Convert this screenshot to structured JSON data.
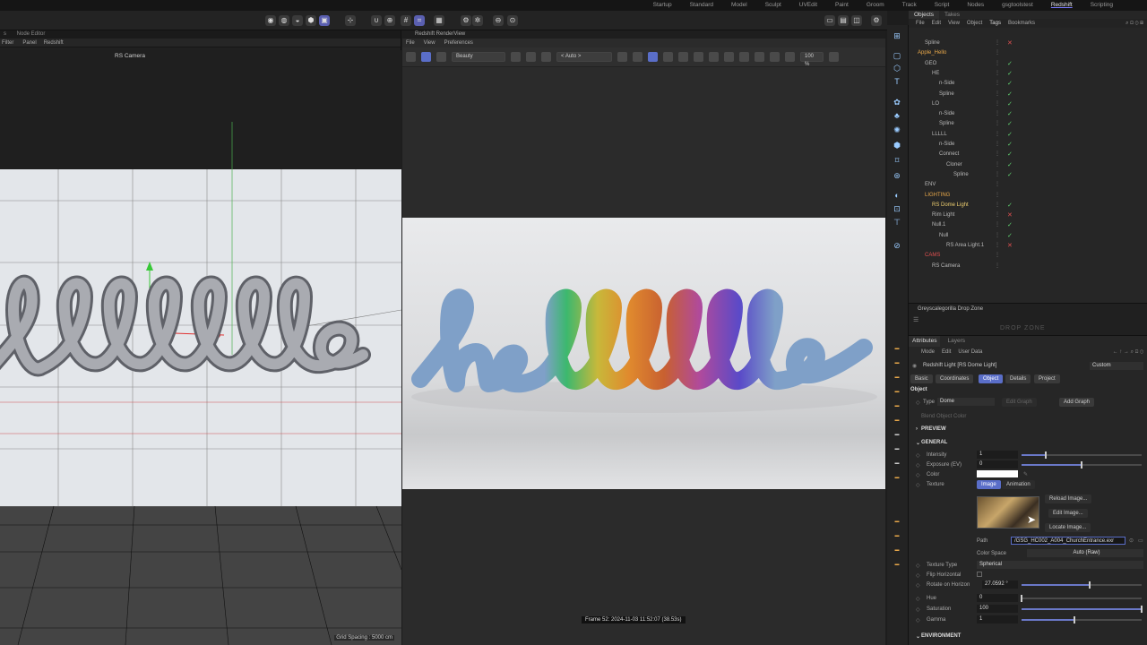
{
  "layouts": [
    "Startup",
    "Standard",
    "Model",
    "Sculpt",
    "UVEdit",
    "Paint",
    "Groom",
    "Track",
    "Script",
    "Nodes",
    "gsgtoolstest",
    "Redshift",
    "Scripting"
  ],
  "layouts_active": "Redshift",
  "left_panel": {
    "tabs": [
      "Node Editor"
    ],
    "menu": [
      "Filter",
      "Panel",
      "Redshift"
    ],
    "camera_label": "RS Camera",
    "grid_spacing": "Grid Spacing : 5000 cm"
  },
  "render_view": {
    "title": "Redshift RenderView",
    "menu": [
      "File",
      "View",
      "Preferences"
    ],
    "aov_select": "Beauty",
    "auto_select": "< Auto >",
    "zoom": "100 %",
    "status": "Frame 52: 2024-11-03 11:52:07 (38.53s)"
  },
  "objects_panel": {
    "tabs": [
      "Objects",
      "Takes"
    ],
    "menu": [
      "File",
      "Edit",
      "View",
      "Object",
      "Tags",
      "Bookmarks"
    ],
    "rows": [
      {
        "name": "Spline",
        "indent": 1,
        "color": "#b8b8b8",
        "check": "✕",
        "checkcolor": "#e05050"
      },
      {
        "name": "Apple_Hello",
        "indent": 0,
        "color": "#e8a84a",
        "check": "",
        "checkcolor": ""
      },
      {
        "name": "GEO",
        "indent": 1,
        "color": "#b8b8b8",
        "check": "✓",
        "checkcolor": "#5fd36f"
      },
      {
        "name": "HE",
        "indent": 2,
        "color": "#b8b8b8",
        "check": "✓",
        "checkcolor": "#5fd36f"
      },
      {
        "name": "n-Side",
        "indent": 3,
        "color": "#b8b8b8",
        "check": "✓",
        "checkcolor": "#5fd36f"
      },
      {
        "name": "Spline",
        "indent": 3,
        "color": "#b8b8b8",
        "check": "✓",
        "checkcolor": "#5fd36f"
      },
      {
        "name": "LO",
        "indent": 2,
        "color": "#b8b8b8",
        "check": "✓",
        "checkcolor": "#5fd36f"
      },
      {
        "name": "n-Side",
        "indent": 3,
        "color": "#b8b8b8",
        "check": "✓",
        "checkcolor": "#5fd36f"
      },
      {
        "name": "Spline",
        "indent": 3,
        "color": "#b8b8b8",
        "check": "✓",
        "checkcolor": "#5fd36f"
      },
      {
        "name": "LLLLL",
        "indent": 2,
        "color": "#b8b8b8",
        "check": "✓",
        "checkcolor": "#5fd36f"
      },
      {
        "name": "n-Side",
        "indent": 3,
        "color": "#b8b8b8",
        "check": "✓",
        "checkcolor": "#5fd36f"
      },
      {
        "name": "Connect",
        "indent": 3,
        "color": "#b8b8b8",
        "check": "✓",
        "checkcolor": "#5fd36f"
      },
      {
        "name": "Cloner",
        "indent": 4,
        "color": "#b8b8b8",
        "check": "✓",
        "checkcolor": "#5fd36f"
      },
      {
        "name": "Spline",
        "indent": 5,
        "color": "#b8b8b8",
        "check": "✓",
        "checkcolor": "#5fd36f"
      },
      {
        "name": "ENV",
        "indent": 1,
        "color": "#b8b8b8",
        "check": "",
        "checkcolor": ""
      },
      {
        "name": "LIGHTING",
        "indent": 1,
        "color": "#e8a84a",
        "check": "",
        "checkcolor": ""
      },
      {
        "name": "RS Dome Light",
        "indent": 2,
        "color": "#f0d070",
        "check": "✓",
        "checkcolor": "#5fd36f"
      },
      {
        "name": "Rim Light",
        "indent": 2,
        "color": "#b8b8b8",
        "check": "✕",
        "checkcolor": "#e05050"
      },
      {
        "name": "Null.1",
        "indent": 2,
        "color": "#b8b8b8",
        "check": "✓",
        "checkcolor": "#5fd36f"
      },
      {
        "name": "Null",
        "indent": 3,
        "color": "#b8b8b8",
        "check": "✓",
        "checkcolor": "#5fd36f"
      },
      {
        "name": "RS Area Light.1",
        "indent": 4,
        "color": "#b8b8b8",
        "check": "✕",
        "checkcolor": "#e05050"
      },
      {
        "name": "CAMS",
        "indent": 1,
        "color": "#e05050",
        "check": "",
        "checkcolor": ""
      },
      {
        "name": "RS Camera",
        "indent": 2,
        "color": "#b8b8b8",
        "check": "",
        "checkcolor": ""
      }
    ]
  },
  "dropzone": {
    "title": "Greyscalegorilla Drop Zone",
    "logo": "DROP ZONE"
  },
  "attributes": {
    "tabs": [
      "Attributes",
      "Layers"
    ],
    "menu": [
      "Mode",
      "Edit",
      "User Data"
    ],
    "object_title": "Redshift Light [RS Dome Light]",
    "custom": "Custom",
    "sub_tabs": [
      "Basic",
      "Coordinates",
      "Object",
      "Details",
      "Project"
    ],
    "sub_tab_active": "Object",
    "section_object": "Object",
    "type_label": "Type",
    "type_value": "Dome",
    "edit_graph": "Edit Graph",
    "add_graph": "Add Graph",
    "blend_label": "Blend Object Color",
    "preview": "PREVIEW",
    "general": "GENERAL",
    "intensity_label": "Intensity",
    "intensity_value": "1",
    "intensity_frac": 0.2,
    "exposure_label": "Exposure (EV)",
    "exposure_value": "0",
    "exposure_frac": 0.5,
    "color_label": "Color",
    "texture_label": "Texture",
    "tex_tabs": [
      "Image",
      "Animation"
    ],
    "reload": "Reload Image...",
    "edit_image": "Edit Image...",
    "locate": "Locate Image...",
    "path_label": "Path",
    "path_value": "/GSG_HC002_A004_ChurchEntrance.exr",
    "colorspace_label": "Color Space",
    "colorspace_value": "Auto (Raw)",
    "textype_label": "Texture Type",
    "textype_value": "Spherical",
    "flip_label": "Flip Horizontal",
    "rotate_label": "Rotate on Horizon",
    "rotate_value": "27.0592 °",
    "rotate_frac": 0.57,
    "hue_label": "Hue",
    "hue_value": "0",
    "hue_frac": 0.0,
    "sat_label": "Saturation",
    "sat_value": "100",
    "sat_frac": 1.0,
    "gamma_label": "Gamma",
    "gamma_value": "1",
    "gamma_frac": 0.44,
    "environment": "ENVIRONMENT"
  },
  "render_text": "helllllo"
}
